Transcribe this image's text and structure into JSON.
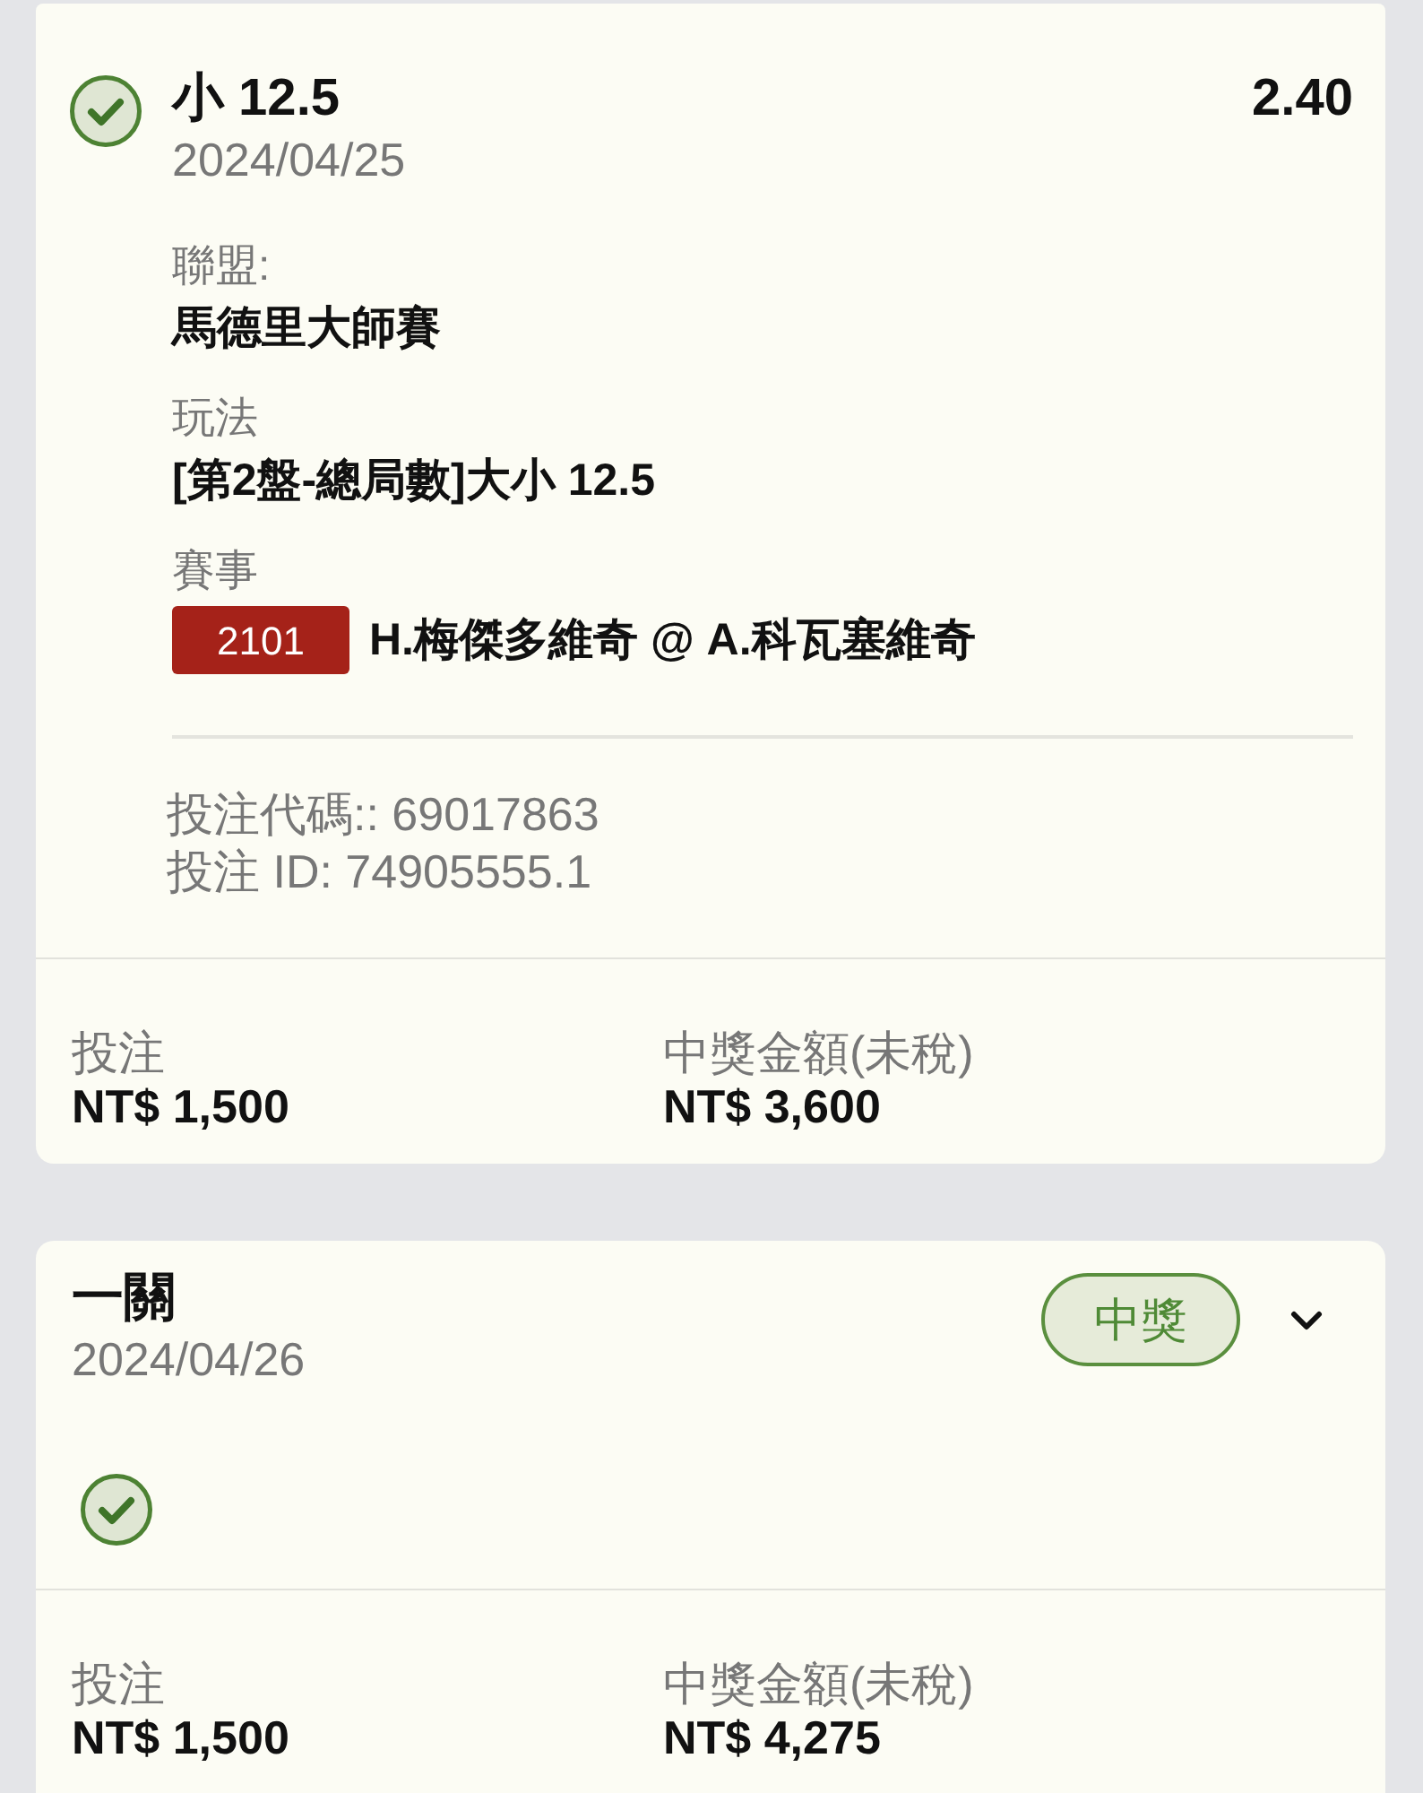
{
  "bets": [
    {
      "kind": "leg_detail",
      "won": true,
      "selection": "小 12.5",
      "date": "2024/04/25",
      "odds": "2.40",
      "details": [
        {
          "label": "聯盟:",
          "value": "馬德里大師賽"
        },
        {
          "label": "玩法",
          "value": "[第2盤-總局數]大小 12.5"
        },
        {
          "label": "賽事",
          "match_code": "2101",
          "value": "H.梅傑多維奇 @ A.科瓦塞維奇"
        }
      ],
      "bet_code": "投注代碼:: 69017863",
      "bet_id": "投注 ID: 74905555.1",
      "stake_label": "投注",
      "stake": "NT$ 1,500",
      "payout_label": "中獎金額(未稅)",
      "payout": "NT$ 3,600"
    },
    {
      "kind": "parlay",
      "title": "一關",
      "date": "2024/04/26",
      "status": "中獎",
      "expanded": false,
      "legs": [
        {
          "won": true
        }
      ],
      "stake_label": "投注",
      "stake": "NT$ 1,500",
      "payout_label": "中獎金額(未稅)",
      "payout": "NT$ 4,275"
    }
  ]
}
